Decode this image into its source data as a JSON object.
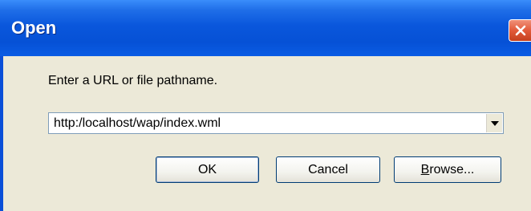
{
  "dialog": {
    "title": "Open",
    "prompt": "Enter a URL or file pathname.",
    "url_value": "http:/localhost/wap/index.wml",
    "buttons": {
      "ok": "OK",
      "cancel": "Cancel",
      "browse_mnemonic": "B",
      "browse_rest": "rowse..."
    }
  },
  "icons": {
    "close": "close-icon",
    "dropdown": "chevron-down-icon"
  },
  "colors": {
    "titlebar": "#0651d6",
    "close_button": "#e25a3a",
    "dialog_background": "#ece9d8"
  }
}
